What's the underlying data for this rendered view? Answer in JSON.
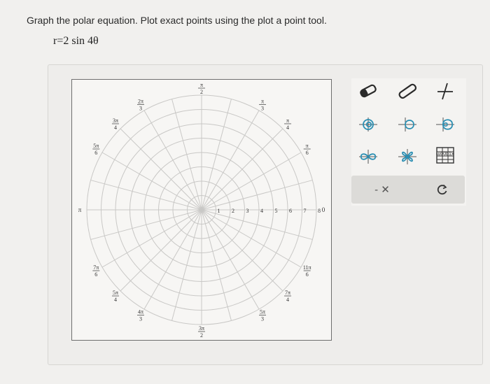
{
  "prompt": {
    "instruction": "Graph the polar equation. Plot exact points using the plot a point tool.",
    "equation": "r=2 sin 4θ"
  },
  "graph": {
    "angle_labels": [
      {
        "name": "angle-label-0",
        "num": "0",
        "den": ""
      },
      {
        "name": "angle-label-pi-6",
        "num": "π",
        "den": "6"
      },
      {
        "name": "angle-label-pi-4",
        "num": "π",
        "den": "4"
      },
      {
        "name": "angle-label-pi-3",
        "num": "π",
        "den": "3"
      },
      {
        "name": "angle-label-pi-2",
        "num": "π",
        "den": "2"
      },
      {
        "name": "angle-label-2pi-3",
        "num": "2π",
        "den": "3"
      },
      {
        "name": "angle-label-3pi-4",
        "num": "3π",
        "den": "4"
      },
      {
        "name": "angle-label-5pi-6",
        "num": "5π",
        "den": "6"
      },
      {
        "name": "angle-label-pi",
        "num": "π",
        "den": ""
      },
      {
        "name": "angle-label-7pi-6",
        "num": "7π",
        "den": "6"
      },
      {
        "name": "angle-label-5pi-4",
        "num": "5π",
        "den": "4"
      },
      {
        "name": "angle-label-4pi-3",
        "num": "4π",
        "den": "3"
      },
      {
        "name": "angle-label-3pi-2",
        "num": "3π",
        "den": "2"
      },
      {
        "name": "angle-label-5pi-3",
        "num": "5π",
        "den": "3"
      },
      {
        "name": "angle-label-7pi-4",
        "num": "7π",
        "den": "4"
      },
      {
        "name": "angle-label-11pi-6",
        "num": "11π",
        "den": "6"
      }
    ],
    "radial_labels": [
      "1",
      "2",
      "3",
      "4",
      "5",
      "6",
      "7",
      "8"
    ],
    "ring_count": 8,
    "spoke_count": 24
  },
  "toolbox": {
    "tools": [
      {
        "name": "point-tool",
        "icon": "point-icon"
      },
      {
        "name": "segment-tool",
        "icon": "segment-icon"
      },
      {
        "name": "cross-point-tool",
        "icon": "cross-point-icon"
      },
      {
        "name": "spiral-tool",
        "icon": "spiral-icon"
      },
      {
        "name": "cardioid-tool",
        "icon": "cardioid-icon"
      },
      {
        "name": "limacon-tool",
        "icon": "limacon-icon"
      },
      {
        "name": "lemniscate-tool",
        "icon": "lemniscate-icon"
      },
      {
        "name": "rose-tool",
        "icon": "rose-icon"
      },
      {
        "name": "function-tool",
        "icon": "function-icon"
      }
    ],
    "delete_label": "- ✕",
    "undo_icon": "undo-icon",
    "accent_color": "#2b8fb3"
  }
}
